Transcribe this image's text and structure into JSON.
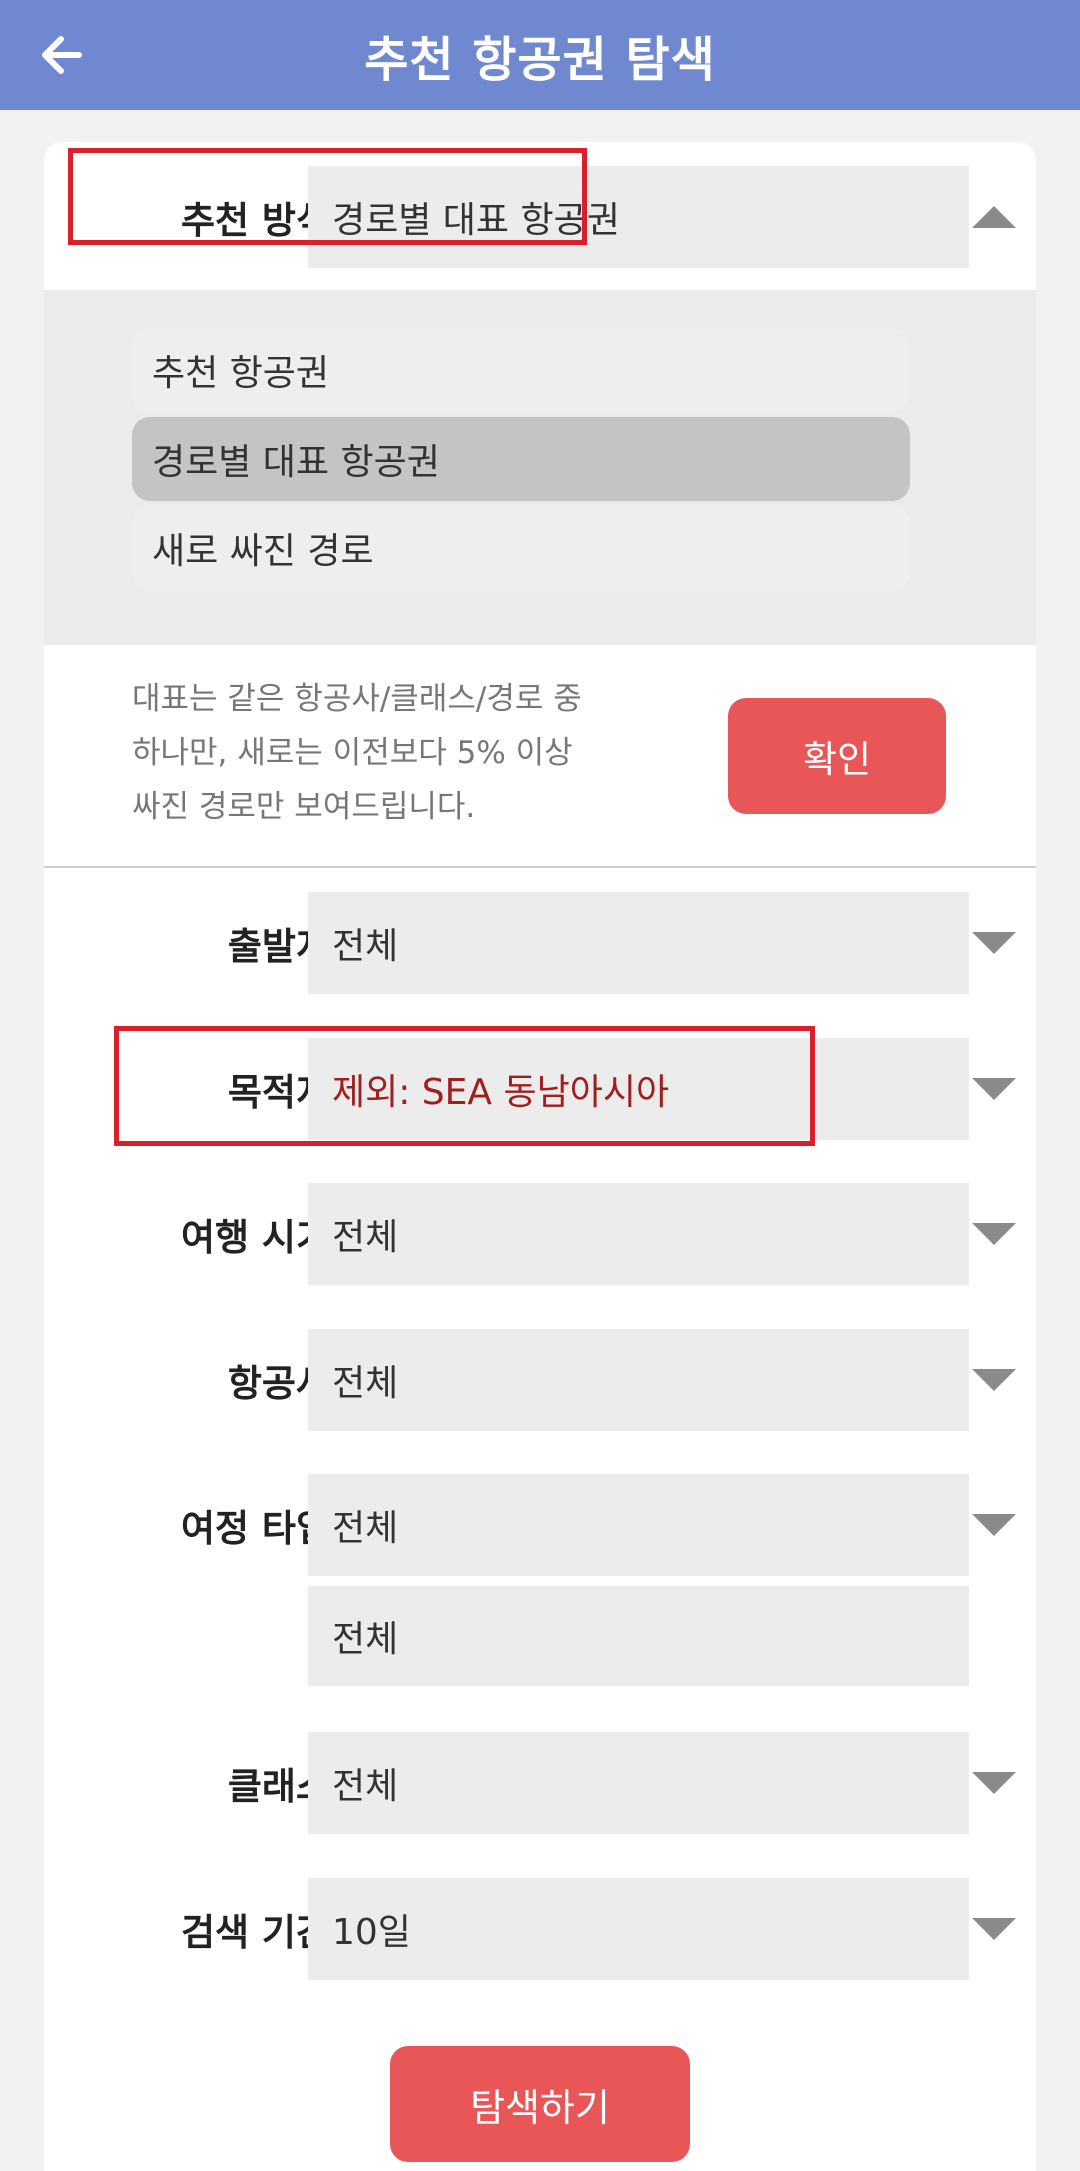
{
  "header": {
    "title": "추천 항공권 탐색",
    "back_icon": "arrow-left-icon"
  },
  "recommend": {
    "label": "추천 방식",
    "value": "경로별 대표 항공권",
    "options": [
      "추천 항공권",
      "경로별 대표 항공권",
      "새로 싸진 경로"
    ],
    "selected_index": 1,
    "description_lines": [
      "대표는 같은 항공사/클래스/경로 중",
      "하나만, 새로는 이전보다 5% 이상",
      "싸진 경로만 보여드립니다."
    ],
    "confirm_label": "확인"
  },
  "filters": {
    "origin": {
      "label": "출발지",
      "value": "전체"
    },
    "destination": {
      "label": "목적지",
      "value": "제외: SEA 동남아시아"
    },
    "travel_period": {
      "label": "여행 시기",
      "value": "전체"
    },
    "airline": {
      "label": "항공사",
      "value": "전체"
    },
    "trip_type": {
      "label": "여정 타입",
      "value": "전체",
      "value2": "전체"
    },
    "cabin_class": {
      "label": "클래스",
      "value": "전체"
    },
    "search_period": {
      "label": "검색 기간",
      "value": "10일"
    }
  },
  "search_button": "탐색하기",
  "colors": {
    "header": "#6f88d0",
    "button": "#e85658",
    "highlight": "#d8202a",
    "excluded_text": "#a11e1e"
  }
}
